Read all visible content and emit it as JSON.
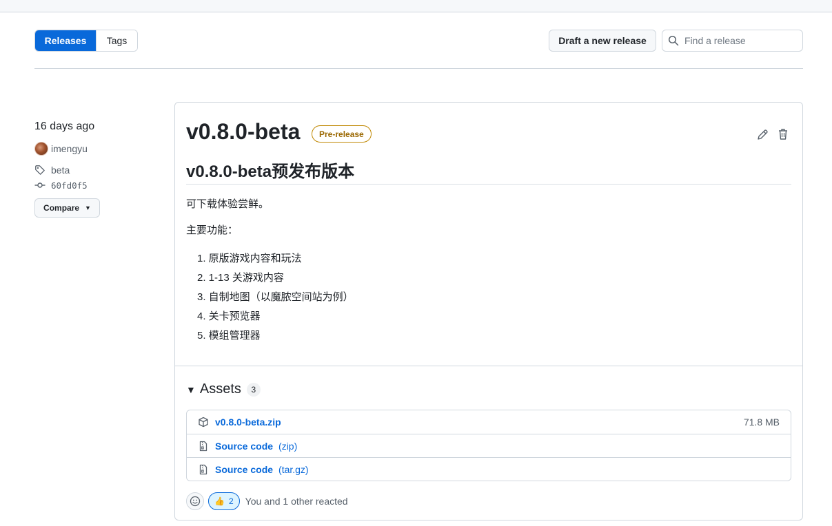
{
  "header": {
    "tabs": [
      {
        "label": "Releases",
        "active": true
      },
      {
        "label": "Tags",
        "active": false
      }
    ],
    "draft_label": "Draft a new release",
    "search_placeholder": "Find a release"
  },
  "release": {
    "date": "16 days ago",
    "author": "imengyu",
    "tag": "beta",
    "commit": "60fd0f5",
    "compare_label": "Compare",
    "title": "v0.8.0-beta",
    "badge": "Pre-release",
    "heading": "v0.8.0-beta预发布版本",
    "paragraph1": "可下载体验尝鲜。",
    "paragraph2": "主要功能：",
    "features": [
      "1. 原版游戏内容和玩法",
      "2. 1-13 关游戏内容",
      "3. 自制地图（以魔脓空间站为例）",
      "4. 关卡预览器",
      "5. 模组管理器"
    ]
  },
  "assets": {
    "label": "Assets",
    "count": "3",
    "items": [
      {
        "name": "v0.8.0-beta.zip",
        "suffix": "",
        "size": "71.8 MB",
        "icon": "package-icon"
      },
      {
        "name": "Source code",
        "suffix": "(zip)",
        "size": "",
        "icon": "file-zip-icon"
      },
      {
        "name": "Source code",
        "suffix": "(tar.gz)",
        "size": "",
        "icon": "file-zip-icon"
      }
    ]
  },
  "reactions": {
    "emoji": "👍",
    "count": "2",
    "text": "You and 1 other reacted"
  },
  "colors": {
    "accent": "#0969da",
    "prerelease": "#9a6700",
    "border": "#d0d7de"
  }
}
